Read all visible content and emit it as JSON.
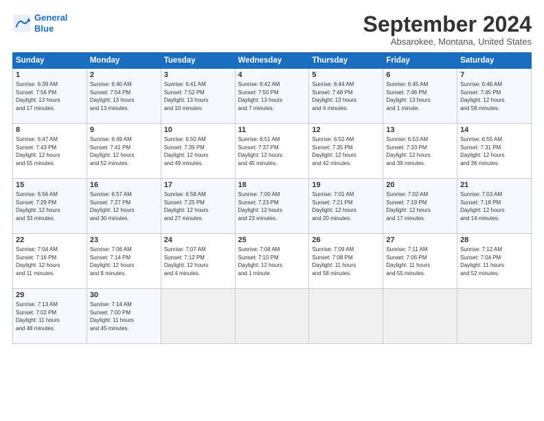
{
  "logo": {
    "line1": "General",
    "line2": "Blue"
  },
  "title": "September 2024",
  "subtitle": "Absarokee, Montana, United States",
  "headers": [
    "Sunday",
    "Monday",
    "Tuesday",
    "Wednesday",
    "Thursday",
    "Friday",
    "Saturday"
  ],
  "weeks": [
    [
      {
        "day": "1",
        "info": "Sunrise: 6:39 AM\nSunset: 7:56 PM\nDaylight: 13 hours\nand 17 minutes."
      },
      {
        "day": "2",
        "info": "Sunrise: 6:40 AM\nSunset: 7:54 PM\nDaylight: 13 hours\nand 13 minutes."
      },
      {
        "day": "3",
        "info": "Sunrise: 6:41 AM\nSunset: 7:52 PM\nDaylight: 13 hours\nand 10 minutes."
      },
      {
        "day": "4",
        "info": "Sunrise: 6:42 AM\nSunset: 7:50 PM\nDaylight: 13 hours\nand 7 minutes."
      },
      {
        "day": "5",
        "info": "Sunrise: 6:44 AM\nSunset: 7:48 PM\nDaylight: 13 hours\nand 4 minutes."
      },
      {
        "day": "6",
        "info": "Sunrise: 6:45 AM\nSunset: 7:46 PM\nDaylight: 13 hours\nand 1 minute."
      },
      {
        "day": "7",
        "info": "Sunrise: 6:46 AM\nSunset: 7:45 PM\nDaylight: 12 hours\nand 58 minutes."
      }
    ],
    [
      {
        "day": "8",
        "info": "Sunrise: 6:47 AM\nSunset: 7:43 PM\nDaylight: 12 hours\nand 55 minutes."
      },
      {
        "day": "9",
        "info": "Sunrise: 6:49 AM\nSunset: 7:41 PM\nDaylight: 12 hours\nand 52 minutes."
      },
      {
        "day": "10",
        "info": "Sunrise: 6:50 AM\nSunset: 7:39 PM\nDaylight: 12 hours\nand 49 minutes."
      },
      {
        "day": "11",
        "info": "Sunrise: 6:51 AM\nSunset: 7:37 PM\nDaylight: 12 hours\nand 45 minutes."
      },
      {
        "day": "12",
        "info": "Sunrise: 6:52 AM\nSunset: 7:35 PM\nDaylight: 12 hours\nand 42 minutes."
      },
      {
        "day": "13",
        "info": "Sunrise: 6:53 AM\nSunset: 7:33 PM\nDaylight: 12 hours\nand 39 minutes."
      },
      {
        "day": "14",
        "info": "Sunrise: 6:55 AM\nSunset: 7:31 PM\nDaylight: 12 hours\nand 36 minutes."
      }
    ],
    [
      {
        "day": "15",
        "info": "Sunrise: 6:56 AM\nSunset: 7:29 PM\nDaylight: 12 hours\nand 33 minutes."
      },
      {
        "day": "16",
        "info": "Sunrise: 6:57 AM\nSunset: 7:27 PM\nDaylight: 12 hours\nand 30 minutes."
      },
      {
        "day": "17",
        "info": "Sunrise: 6:58 AM\nSunset: 7:25 PM\nDaylight: 12 hours\nand 27 minutes."
      },
      {
        "day": "18",
        "info": "Sunrise: 7:00 AM\nSunset: 7:23 PM\nDaylight: 12 hours\nand 23 minutes."
      },
      {
        "day": "19",
        "info": "Sunrise: 7:01 AM\nSunset: 7:21 PM\nDaylight: 12 hours\nand 20 minutes."
      },
      {
        "day": "20",
        "info": "Sunrise: 7:02 AM\nSunset: 7:19 PM\nDaylight: 12 hours\nand 17 minutes."
      },
      {
        "day": "21",
        "info": "Sunrise: 7:03 AM\nSunset: 7:18 PM\nDaylight: 12 hours\nand 14 minutes."
      }
    ],
    [
      {
        "day": "22",
        "info": "Sunrise: 7:04 AM\nSunset: 7:16 PM\nDaylight: 12 hours\nand 11 minutes."
      },
      {
        "day": "23",
        "info": "Sunrise: 7:06 AM\nSunset: 7:14 PM\nDaylight: 12 hours\nand 8 minutes."
      },
      {
        "day": "24",
        "info": "Sunrise: 7:07 AM\nSunset: 7:12 PM\nDaylight: 12 hours\nand 4 minutes."
      },
      {
        "day": "25",
        "info": "Sunrise: 7:08 AM\nSunset: 7:10 PM\nDaylight: 12 hours\nand 1 minute."
      },
      {
        "day": "26",
        "info": "Sunrise: 7:09 AM\nSunset: 7:08 PM\nDaylight: 11 hours\nand 58 minutes."
      },
      {
        "day": "27",
        "info": "Sunrise: 7:11 AM\nSunset: 7:06 PM\nDaylight: 11 hours\nand 55 minutes."
      },
      {
        "day": "28",
        "info": "Sunrise: 7:12 AM\nSunset: 7:04 PM\nDaylight: 11 hours\nand 52 minutes."
      }
    ],
    [
      {
        "day": "29",
        "info": "Sunrise: 7:13 AM\nSunset: 7:02 PM\nDaylight: 11 hours\nand 48 minutes."
      },
      {
        "day": "30",
        "info": "Sunrise: 7:14 AM\nSunset: 7:00 PM\nDaylight: 11 hours\nand 45 minutes."
      },
      {
        "day": "",
        "info": ""
      },
      {
        "day": "",
        "info": ""
      },
      {
        "day": "",
        "info": ""
      },
      {
        "day": "",
        "info": ""
      },
      {
        "day": "",
        "info": ""
      }
    ]
  ]
}
